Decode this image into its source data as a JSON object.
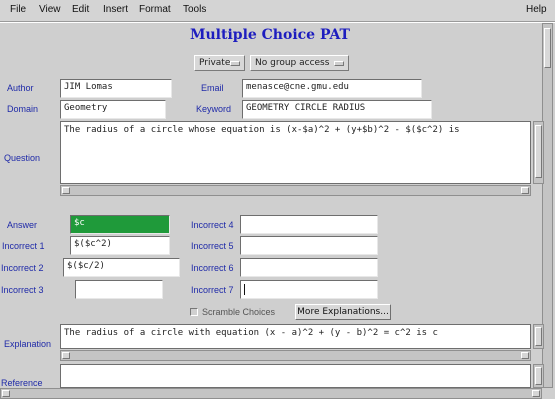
{
  "menu": {
    "file": "File",
    "view": "View",
    "edit": "Edit",
    "insert": "Insert",
    "format": "Format",
    "tools": "Tools",
    "help": "Help"
  },
  "title": "Multiple Choice PAT",
  "access": {
    "visibility": "Private",
    "group": "No group access"
  },
  "fields": {
    "author_label": "Author",
    "author_value": "JIM Lomas",
    "email_label": "Email",
    "email_value": "menasce@cne.gmu.edu",
    "domain_label": "Domain",
    "domain_value": "Geometry",
    "keyword_label": "Keyword",
    "keyword_value": "GEOMETRY CIRCLE RADIUS",
    "question_label": "Question",
    "question_value": "The radius of a circle whose equation is (x-$a)^2 + (y+$b)^2 - $($c^2) is"
  },
  "answers": {
    "answer_label": "Answer",
    "answer_value": "$c",
    "incorrect1_label": "Incorrect 1",
    "incorrect1_value": "$($c^2)",
    "incorrect2_label": "Incorrect 2",
    "incorrect2_value": "$($c/2)",
    "incorrect3_label": "Incorrect 3",
    "incorrect3_value": "",
    "incorrect4_label": "Incorrect 4",
    "incorrect4_value": "",
    "incorrect5_label": "Incorrect 5",
    "incorrect5_value": "",
    "incorrect6_label": "Incorrect 6",
    "incorrect6_value": "",
    "incorrect7_label": "Incorrect 7",
    "incorrect7_value": ""
  },
  "options": {
    "scramble_label": "Scramble Choices",
    "scramble_checked": false,
    "more_explanations": "More Explanations..."
  },
  "explanation": {
    "label": "Explanation",
    "value": "The radius of a circle with equation (x - a)^2 + (y - b)^2 = c^2 is c"
  },
  "reference": {
    "label": "Reference",
    "value": ""
  },
  "colors": {
    "label": "#1f2aa8",
    "title": "#1d1dbf",
    "answer_highlight": "#1f9a3a",
    "background": "#cfcfcf"
  }
}
